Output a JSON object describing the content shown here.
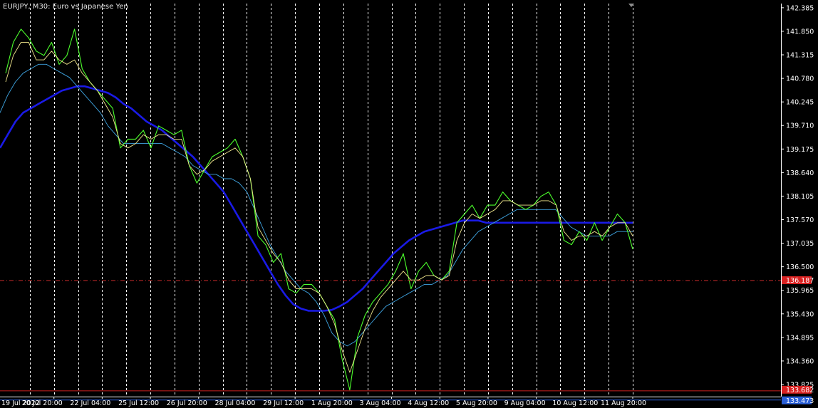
{
  "chart_title": "EURJPY, M30:  Euro vs Japanese Yen",
  "colors": {
    "background": "#000000",
    "axis": "#ffffff",
    "grid": "#ffffff",
    "price": "#4cff2c",
    "ma_fast": "#f0e68c",
    "ma_mid": "#3ea3e0",
    "ma_slow": "#1a1ae6",
    "level_line": "#cc2a2a",
    "level_tag": "#d82020",
    "low_line": "#cc2020",
    "ask_line": "#2a5fd6"
  },
  "chart_data": {
    "type": "line",
    "symbol": "EURJPY",
    "timeframe": "M30",
    "ylim": [
      133.55,
      142.48
    ],
    "y_ticks": [
      "142.385",
      "141.850",
      "141.315",
      "140.780",
      "140.245",
      "139.710",
      "139.175",
      "138.640",
      "138.105",
      "137.570",
      "137.035",
      "136.500",
      "135.965",
      "135.430",
      "134.895",
      "134.360",
      "133.825"
    ],
    "x_ticks": [
      "19 Jul 2022",
      "20 Jul 20:00",
      "22 Jul 04:00",
      "25 Jul 12:00",
      "26 Jul 20:00",
      "28 Jul 04:00",
      "29 Jul 12:00",
      "1 Aug 20:00",
      "3 Aug 04:00",
      "4 Aug 12:00",
      "5 Aug 20:00",
      "9 Aug 04:00",
      "10 Aug 12:00",
      "11 Aug 20:00"
    ],
    "price_labels": [
      {
        "value": 136.187,
        "text": "136.187"
      },
      {
        "value": 133.682,
        "text": "133.682"
      },
      {
        "value": 133.473,
        "text": "133.473"
      }
    ],
    "series": [
      {
        "key": "price",
        "values": [
          140.9,
          141.6,
          141.9,
          141.7,
          141.4,
          141.3,
          141.6,
          141.1,
          141.3,
          141.9,
          141.0,
          140.7,
          140.5,
          140.3,
          140.1,
          139.2,
          139.4,
          139.4,
          139.6,
          139.2,
          139.7,
          139.6,
          139.5,
          139.6,
          138.8,
          138.4,
          138.7,
          139.0,
          139.1,
          139.2,
          139.4,
          139.0,
          138.5,
          137.2,
          137.0,
          136.6,
          136.8,
          136.0,
          135.9,
          136.1,
          136.1,
          135.9,
          135.6,
          135.3,
          134.4,
          133.7,
          134.9,
          135.4,
          135.7,
          135.9,
          136.1,
          136.4,
          136.8,
          136.0,
          136.4,
          136.6,
          136.3,
          136.2,
          136.4,
          137.5,
          137.7,
          137.9,
          137.6,
          137.9,
          137.9,
          138.2,
          138.0,
          137.9,
          137.8,
          137.9,
          138.1,
          138.2,
          137.9,
          137.1,
          137.0,
          137.3,
          137.1,
          137.5,
          137.1,
          137.4,
          137.7,
          137.5,
          136.9
        ]
      },
      {
        "key": "ma_fast",
        "values": [
          140.7,
          141.3,
          141.6,
          141.6,
          141.2,
          141.2,
          141.4,
          141.2,
          141.1,
          141.2,
          140.9,
          140.7,
          140.5,
          140.2,
          139.9,
          139.3,
          139.2,
          139.3,
          139.5,
          139.4,
          139.5,
          139.5,
          139.4,
          139.4,
          138.8,
          138.6,
          138.7,
          138.9,
          139.0,
          139.1,
          139.2,
          139.0,
          138.5,
          137.4,
          137.1,
          136.8,
          136.6,
          136.2,
          136.0,
          136.0,
          136.0,
          135.9,
          135.6,
          135.2,
          134.6,
          134.1,
          134.6,
          135.1,
          135.5,
          135.8,
          136.0,
          136.2,
          136.4,
          136.2,
          136.2,
          136.3,
          136.3,
          136.2,
          136.3,
          137.1,
          137.5,
          137.7,
          137.6,
          137.7,
          137.8,
          138.0,
          138.0,
          137.9,
          137.9,
          137.9,
          138.0,
          138.0,
          137.9,
          137.3,
          137.1,
          137.2,
          137.2,
          137.3,
          137.2,
          137.4,
          137.5,
          137.5,
          137.2
        ]
      },
      {
        "key": "ma_mid",
        "values": [
          140.0,
          140.4,
          140.7,
          140.9,
          141.0,
          141.1,
          141.1,
          141.0,
          140.9,
          140.8,
          140.6,
          140.4,
          140.2,
          140.0,
          139.7,
          139.5,
          139.3,
          139.3,
          139.3,
          139.3,
          139.3,
          139.3,
          139.2,
          139.1,
          139.0,
          138.8,
          138.7,
          138.6,
          138.6,
          138.5,
          138.5,
          138.4,
          138.2,
          137.8,
          137.4,
          137.0,
          136.7,
          136.4,
          136.2,
          136.0,
          135.9,
          135.7,
          135.4,
          135.0,
          134.8,
          134.7,
          134.8,
          135.0,
          135.2,
          135.4,
          135.6,
          135.7,
          135.8,
          135.9,
          136.0,
          136.1,
          136.1,
          136.2,
          136.3,
          136.6,
          136.9,
          137.1,
          137.3,
          137.4,
          137.5,
          137.6,
          137.7,
          137.8,
          137.8,
          137.8,
          137.8,
          137.8,
          137.8,
          137.6,
          137.4,
          137.3,
          137.2,
          137.2,
          137.2,
          137.2,
          137.3,
          137.3,
          137.3
        ]
      },
      {
        "key": "ma_slow",
        "values": [
          139.2,
          139.5,
          139.8,
          140.0,
          140.1,
          140.2,
          140.3,
          140.4,
          140.5,
          140.55,
          140.6,
          140.6,
          140.55,
          140.5,
          140.45,
          140.35,
          140.2,
          140.1,
          139.95,
          139.8,
          139.7,
          139.6,
          139.45,
          139.3,
          139.15,
          139.0,
          138.8,
          138.6,
          138.4,
          138.2,
          137.9,
          137.6,
          137.3,
          137.0,
          136.7,
          136.4,
          136.1,
          135.85,
          135.65,
          135.55,
          135.5,
          135.5,
          135.5,
          135.52,
          135.6,
          135.7,
          135.85,
          136.0,
          136.2,
          136.4,
          136.6,
          136.8,
          136.95,
          137.1,
          137.2,
          137.3,
          137.35,
          137.4,
          137.45,
          137.5,
          137.55,
          137.55,
          137.55,
          137.5,
          137.5,
          137.5,
          137.5,
          137.5,
          137.5,
          137.5,
          137.5,
          137.5,
          137.5,
          137.5,
          137.5,
          137.5,
          137.5,
          137.5,
          137.5,
          137.5,
          137.5,
          137.5,
          137.5
        ]
      }
    ]
  }
}
